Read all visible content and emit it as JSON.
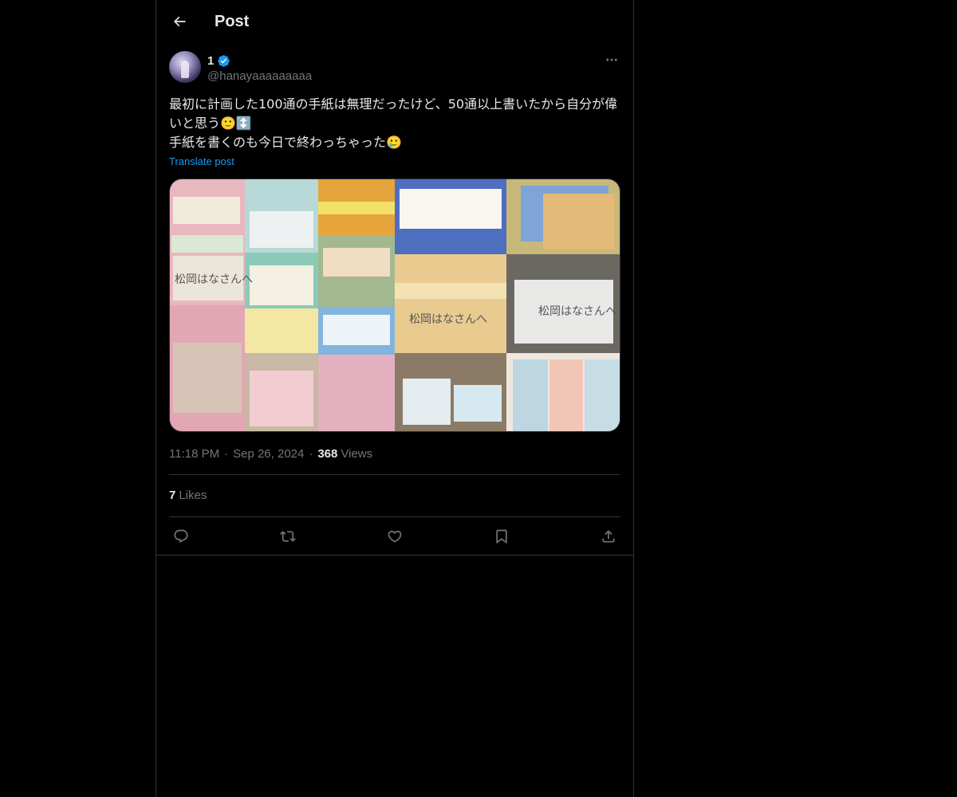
{
  "header": {
    "title": "Post",
    "back_icon": "arrow-left-icon"
  },
  "post": {
    "author": {
      "display_name": "1",
      "handle": "@hanayaaaaaaaaa",
      "verified": true,
      "verified_color": "#1d9bf0"
    },
    "text": "最初に計画した100通の手紙は無理だったけど、50通以上書いたから自分が偉いと思う🙂↕️\n手紙を書くのも今日で終わっちゃった🥲",
    "translate_label": "Translate post",
    "image_handwriting": "松岡はなさんへ",
    "time": "11:18 PM",
    "date": "Sep 26, 2024",
    "views_count": "368",
    "views_label": "Views",
    "likes_count": "7",
    "likes_label": "Likes"
  },
  "actions": [
    {
      "name": "reply",
      "icon": "reply-icon"
    },
    {
      "name": "repost",
      "icon": "repost-icon"
    },
    {
      "name": "like",
      "icon": "heart-icon"
    },
    {
      "name": "bookmark",
      "icon": "bookmark-icon"
    },
    {
      "name": "share",
      "icon": "share-icon"
    }
  ],
  "colors": {
    "background": "#000000",
    "text_primary": "#e7e9ea",
    "text_secondary": "#71767b",
    "accent": "#1d9bf0",
    "border": "#2f3336"
  }
}
